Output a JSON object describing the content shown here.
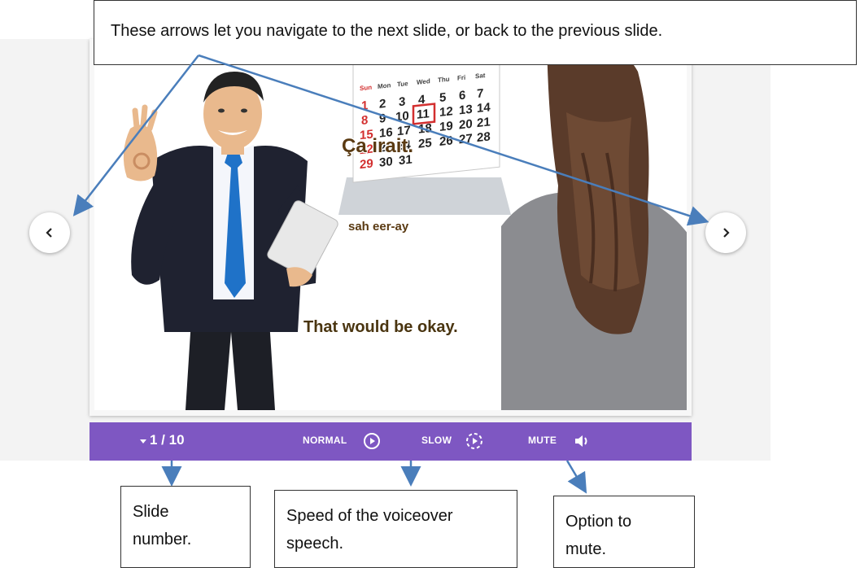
{
  "slide": {
    "phrase": "Ça irait.",
    "pronunciation": "sah eer-ay",
    "translation": "That would be okay.",
    "calendar": {
      "day_headers": [
        "Sun",
        "Mon",
        "Tue",
        "Wed",
        "Thu",
        "Fri",
        "Sat"
      ],
      "highlighted_date": "11",
      "visible_dates": [
        "1",
        "2",
        "3",
        "4",
        "5",
        "6",
        "7",
        "8",
        "9",
        "10",
        "11",
        "12",
        "13",
        "14",
        "15",
        "16",
        "17",
        "18",
        "19",
        "20",
        "21",
        "22",
        "23",
        "24",
        "25",
        "26",
        "27",
        "28",
        "29",
        "30",
        "31"
      ]
    }
  },
  "controls": {
    "slide_number": "1 / 10",
    "normal_label": "NORMAL",
    "slow_label": "SLOW",
    "mute_label": "MUTE",
    "bar_color": "#7e57c2"
  },
  "nav": {
    "prev_icon": "chevron-left-icon",
    "next_icon": "chevron-right-icon"
  },
  "annotations": {
    "arrows_text": "These arrows let you navigate to the next slide, or back to the previous slide.",
    "slide_number_text": "Slide number.",
    "speed_text": "Speed of the voiceover speech.",
    "mute_text": "Option to mute."
  },
  "colors": {
    "annotation_arrow": "#4a7ebb",
    "calendar_red": "#d32f2f",
    "text_brown": "#5a3a12"
  }
}
